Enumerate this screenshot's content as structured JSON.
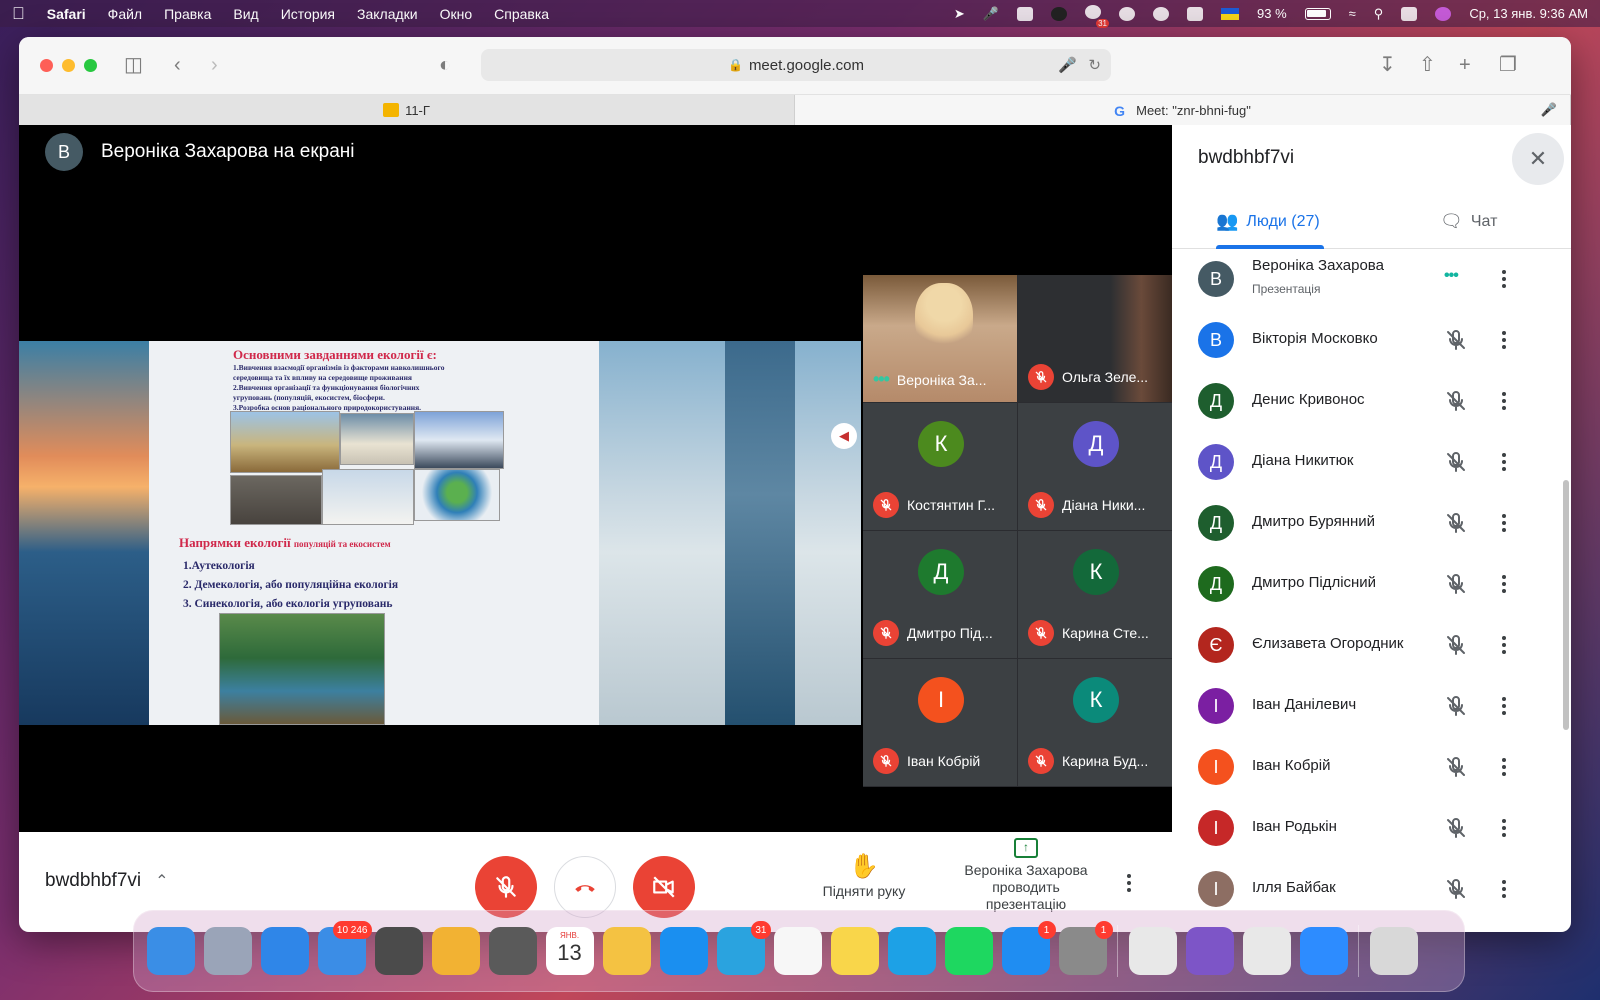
{
  "menubar": {
    "app": "Safari",
    "menus": [
      "Файл",
      "Правка",
      "Вид",
      "История",
      "Закладки",
      "Окно",
      "Справка"
    ],
    "calendar_badge": "31",
    "battery": "93 %",
    "battery_level": 0.93,
    "datetime": "Ср, 13 янв.  9:36 AM"
  },
  "browser": {
    "url": "meet.google.com",
    "tabs": [
      {
        "label": "11-Г",
        "active": false
      },
      {
        "label": "Meet: \"znr-bhni-fug\"",
        "active": true
      }
    ]
  },
  "meet": {
    "presenter_initial": "В",
    "presenter_text": "Вероніка Захарова на екрані",
    "slide": {
      "title": "Основними завданнями екології є:",
      "items": [
        "1.Вивчення взаємодії організмів із факторами навколишнього",
        "середовища та їх впливу на середовище проживання",
        "2.Вивчення організації та функціонування біологічних",
        "угруповань (популяцій, екосистем, біосфери.",
        "3.Розробка основ раціонального природокористування."
      ],
      "subtitle": "Напрямки екології",
      "subtitle_small": "популяцій та екосистем",
      "directions": [
        "1.Аутекологія",
        "2. Демекологія, або популяційна екологія",
        "3. Синекологія, або екологія угруповань"
      ]
    },
    "tiles": [
      {
        "name": "Вероніка За...",
        "video": true,
        "status": "speaking"
      },
      {
        "name": "Ольга Зеле...",
        "video": true,
        "status": "muted"
      },
      {
        "name": "Костянтин Г...",
        "initial": "К",
        "color": "#4c8a1e",
        "status": "muted"
      },
      {
        "name": "Діана Ники...",
        "initial": "Д",
        "color": "#5e54c8",
        "status": "muted"
      },
      {
        "name": "Дмитро Під...",
        "initial": "Д",
        "color": "#1e7a2e",
        "status": "muted"
      },
      {
        "name": "Карина Сте...",
        "initial": "К",
        "color": "#13693a",
        "status": "muted"
      },
      {
        "name": "Іван Кобрій",
        "initial": "І",
        "color": "#f4511e",
        "status": "muted"
      },
      {
        "name": "Карина Буд...",
        "initial": "К",
        "color": "#0b8a7a",
        "status": "muted"
      }
    ],
    "meeting_code": "bwdbhbf7vi",
    "raise_hand": "Підняти руку",
    "presenting": "Вероніка Захарова проводить презентацію"
  },
  "panel": {
    "title": "bwdbhbf7vi",
    "tab_people": "Люди (27)",
    "tab_chat": "Чат",
    "participants": [
      {
        "initial": "В",
        "name": "Вероніка Захарова",
        "sub": "Презентація",
        "color": "#455a64",
        "status": "speaking"
      },
      {
        "initial": "В",
        "name": "Вікторія Московко",
        "color": "#1a73e8",
        "status": "muted"
      },
      {
        "initial": "Д",
        "name": "Денис Кривонос",
        "color": "#1e5e2e",
        "status": "muted"
      },
      {
        "initial": "Д",
        "name": "Діана Никитюк",
        "color": "#5e54c8",
        "status": "muted"
      },
      {
        "initial": "Д",
        "name": "Дмитро Бурянний",
        "color": "#1e5e2e",
        "status": "muted"
      },
      {
        "initial": "Д",
        "name": "Дмитро Підлісний",
        "color": "#1e6a1e",
        "status": "muted"
      },
      {
        "initial": "Є",
        "name": "Єлизавета Огородник",
        "color": "#b3261e",
        "status": "muted"
      },
      {
        "initial": "І",
        "name": "Іван Данілевич",
        "color": "#7b1fa2",
        "status": "muted"
      },
      {
        "initial": "І",
        "name": "Іван Кобрій",
        "color": "#f4511e",
        "status": "muted"
      },
      {
        "initial": "І",
        "name": "Іван Родькін",
        "color": "#c62828",
        "status": "muted"
      },
      {
        "initial": "І",
        "name": "Ілля Байбак",
        "color": "#8d6e63",
        "status": "muted"
      }
    ]
  },
  "dock": {
    "apps": [
      {
        "name": "finder-icon",
        "color": "#3a8ee6"
      },
      {
        "name": "launchpad-icon",
        "color": "#9aa4b8"
      },
      {
        "name": "safari-icon",
        "color": "#2f86e8"
      },
      {
        "name": "mail-icon",
        "color": "#3b8de6",
        "badge": "10 246"
      },
      {
        "name": "screenshot-icon",
        "color": "#4b4b4b"
      },
      {
        "name": "photos-icon",
        "color": "#f2b233"
      },
      {
        "name": "calculator-icon",
        "color": "#5a5a5a"
      },
      {
        "name": "calendar-icon",
        "color": "#ffffff",
        "text": "13",
        "top_text": "ЯНВ."
      },
      {
        "name": "pages-icon",
        "color": "#f4c242"
      },
      {
        "name": "shazam-icon",
        "color": "#1a8ff0"
      },
      {
        "name": "telegram-icon",
        "color": "#2aa3df",
        "badge": "31"
      },
      {
        "name": "reminders-icon",
        "color": "#f7f7f7"
      },
      {
        "name": "notes-icon",
        "color": "#f9d64a"
      },
      {
        "name": "skype-icon",
        "color": "#1da1e6"
      },
      {
        "name": "spotify-icon",
        "color": "#1ed760"
      },
      {
        "name": "appstore-icon",
        "color": "#1f8df2",
        "badge": "1"
      },
      {
        "name": "system-preferences-icon",
        "color": "#8a8a8a",
        "badge": "1"
      },
      {
        "name": "chrome-icon",
        "color": "#e8e8e8"
      },
      {
        "name": "viber-icon",
        "color": "#7d55c7"
      },
      {
        "name": "microsoft-office-icon",
        "color": "#e8e8e8"
      },
      {
        "name": "zoom-icon",
        "color": "#2d8cff"
      },
      {
        "name": "trash-icon",
        "color": "#d8d8d8"
      }
    ]
  }
}
